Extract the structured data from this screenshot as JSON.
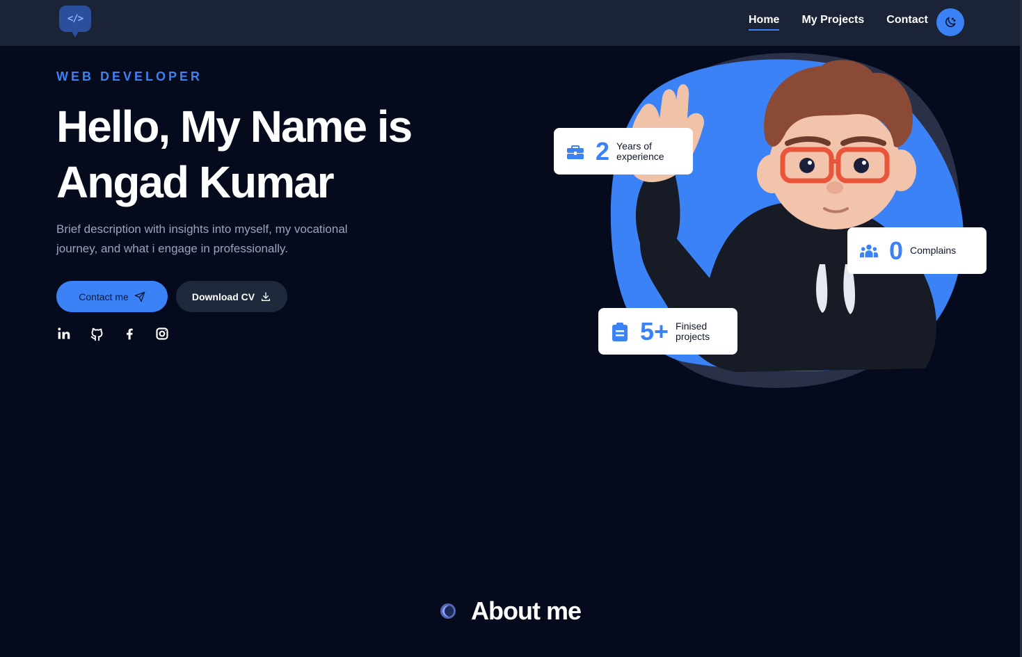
{
  "header": {
    "logo_glyph": "</>",
    "nav": [
      {
        "label": "Home",
        "active": true
      },
      {
        "label": "My Projects",
        "active": false
      },
      {
        "label": "Contact",
        "active": false
      }
    ],
    "theme_icon": "moon-icon"
  },
  "hero": {
    "role": "WEB DEVELOPER",
    "headline_line1": "Hello, My Name is",
    "headline_line2": "Angad Kumar",
    "description": "Brief description with insights into myself, my vocational journey, and what i engage in professionally.",
    "contact_button": "Contact me",
    "download_button": "Download CV",
    "socials": [
      "linkedin-icon",
      "github-icon",
      "facebook-icon",
      "instagram-icon"
    ]
  },
  "stats": {
    "experience": {
      "number": "2",
      "label_line1": "Years of",
      "label_line2": "experience",
      "icon": "briefcase-icon"
    },
    "complains": {
      "number": "0",
      "label": "Complains",
      "icon": "users-icon"
    },
    "projects": {
      "number": "5+",
      "label_line1": "Finised",
      "label_line2": "projects",
      "icon": "clipboard-icon"
    }
  },
  "about": {
    "title": "About me"
  },
  "colors": {
    "accent": "#3b82f6",
    "background": "#050a1c",
    "header": "#1b2436"
  }
}
